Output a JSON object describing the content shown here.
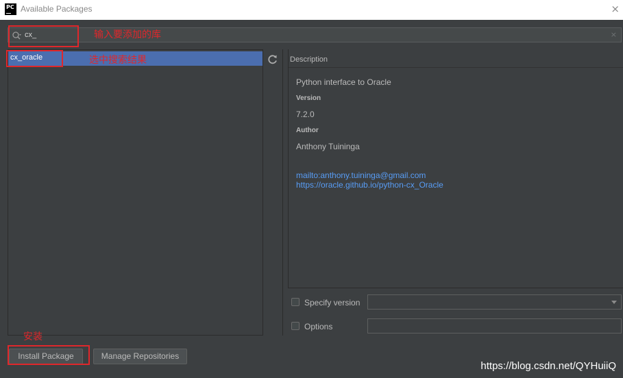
{
  "window": {
    "app_icon_text": "PC",
    "title": "Available Packages",
    "close_glyph": "×"
  },
  "search": {
    "value": "cx_",
    "clear_glyph": "×"
  },
  "packages": [
    {
      "name": "cx_oracle",
      "selected": true
    }
  ],
  "description": {
    "header": "Description",
    "summary": "Python interface to Oracle",
    "version_label": "Version",
    "version_value": "7.2.0",
    "author_label": "Author",
    "author_value": "Anthony Tuininga",
    "email_link": "mailto:anthony.tuininga@gmail.com",
    "homepage_link": "https://oracle.github.io/python-cx_Oracle"
  },
  "options": {
    "specify_version_label": "Specify version",
    "options_label": "Options"
  },
  "buttons": {
    "install": "Install Package",
    "manage_repositories": "Manage Repositories"
  },
  "annotations": {
    "search_hint": "输入要添加的库",
    "select_hint": "选中搜索结果",
    "install_hint": "安装"
  },
  "watermark": "https://blog.csdn.net/QYHuiiQ",
  "colors": {
    "background": "#3c3f41",
    "selection": "#4b6eaf",
    "link": "#589df6",
    "annotation": "#e0272b"
  }
}
